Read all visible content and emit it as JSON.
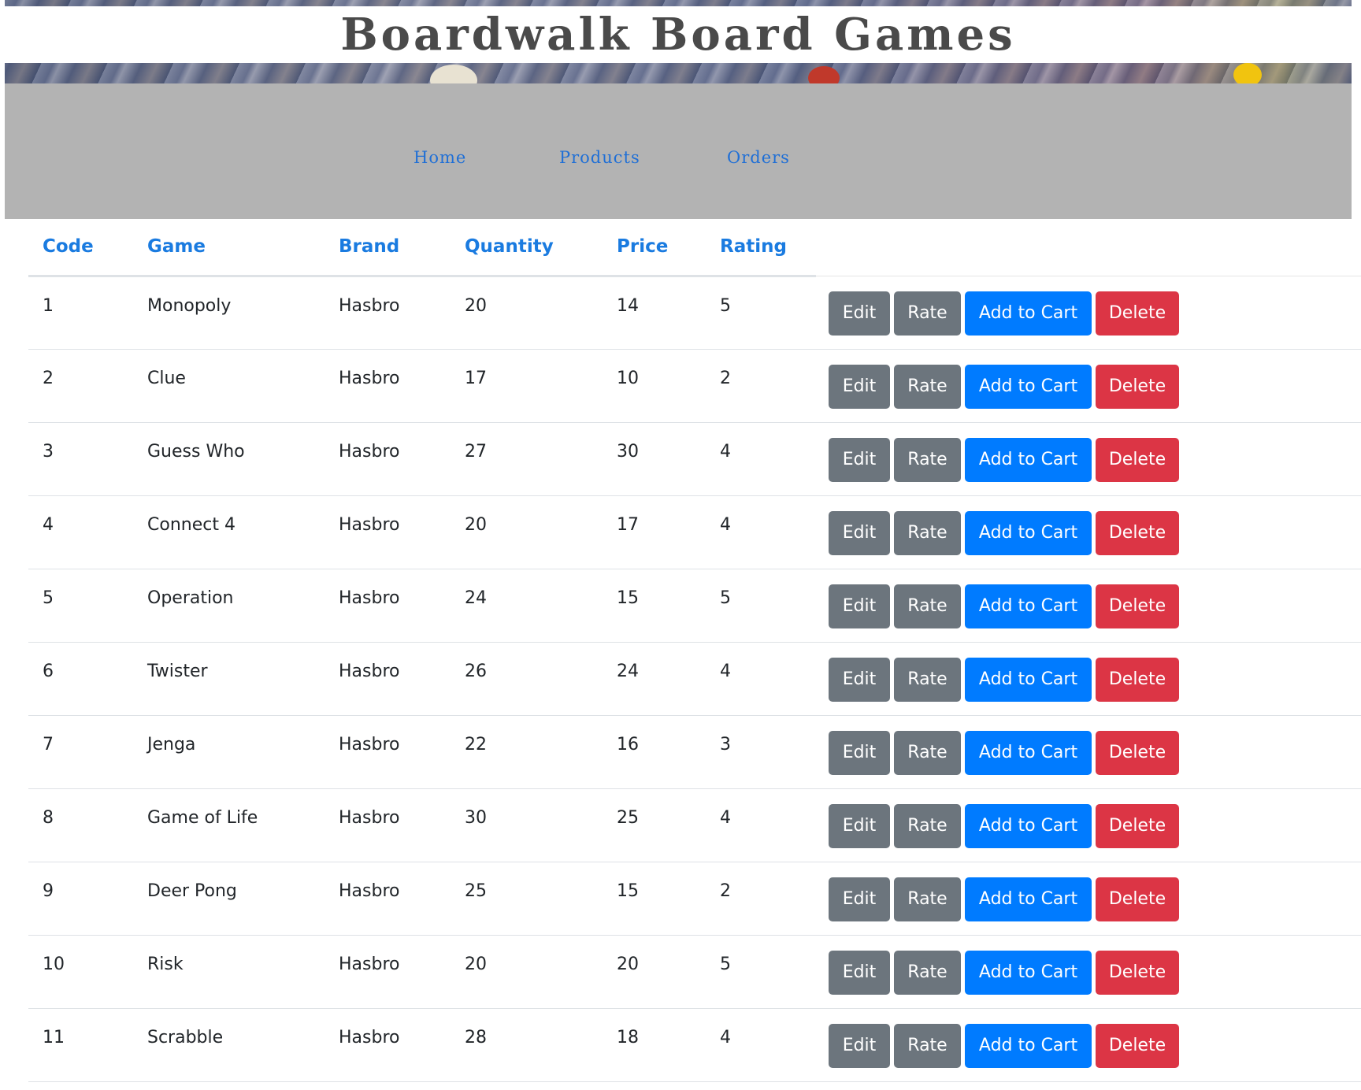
{
  "site": {
    "title": "Boardwalk Board Games"
  },
  "nav": {
    "items": [
      {
        "label": "Home"
      },
      {
        "label": "Products"
      },
      {
        "label": "Orders"
      }
    ],
    "link_color": "#1f6fd6",
    "background": "#b3b3b3"
  },
  "table": {
    "headers": {
      "code": "Code",
      "game": "Game",
      "brand": "Brand",
      "quantity": "Quantity",
      "price": "Price",
      "rating": "Rating"
    },
    "header_color": "#1a7be0",
    "actions": {
      "edit": "Edit",
      "rate": "Rate",
      "add_to_cart": "Add to Cart",
      "delete": "Delete"
    },
    "rows": [
      {
        "code": "1",
        "game": "Monopoly",
        "brand": "Hasbro",
        "quantity": "20",
        "price": "14",
        "rating": "5"
      },
      {
        "code": "2",
        "game": "Clue",
        "brand": "Hasbro",
        "quantity": "17",
        "price": "10",
        "rating": "2"
      },
      {
        "code": "3",
        "game": "Guess Who",
        "brand": "Hasbro",
        "quantity": "27",
        "price": "30",
        "rating": "4"
      },
      {
        "code": "4",
        "game": "Connect 4",
        "brand": "Hasbro",
        "quantity": "20",
        "price": "17",
        "rating": "4"
      },
      {
        "code": "5",
        "game": "Operation",
        "brand": "Hasbro",
        "quantity": "24",
        "price": "15",
        "rating": "5"
      },
      {
        "code": "6",
        "game": "Twister",
        "brand": "Hasbro",
        "quantity": "26",
        "price": "24",
        "rating": "4"
      },
      {
        "code": "7",
        "game": "Jenga",
        "brand": "Hasbro",
        "quantity": "22",
        "price": "16",
        "rating": "3"
      },
      {
        "code": "8",
        "game": "Game of Life",
        "brand": "Hasbro",
        "quantity": "30",
        "price": "25",
        "rating": "4"
      },
      {
        "code": "9",
        "game": "Deer Pong",
        "brand": "Hasbro",
        "quantity": "25",
        "price": "15",
        "rating": "2"
      },
      {
        "code": "10",
        "game": "Risk",
        "brand": "Hasbro",
        "quantity": "20",
        "price": "20",
        "rating": "5"
      },
      {
        "code": "11",
        "game": "Scrabble",
        "brand": "Hasbro",
        "quantity": "28",
        "price": "18",
        "rating": "4"
      }
    ]
  },
  "colors": {
    "button_secondary": "#6c757d",
    "button_primary": "#007bff",
    "button_danger": "#dc3545"
  }
}
